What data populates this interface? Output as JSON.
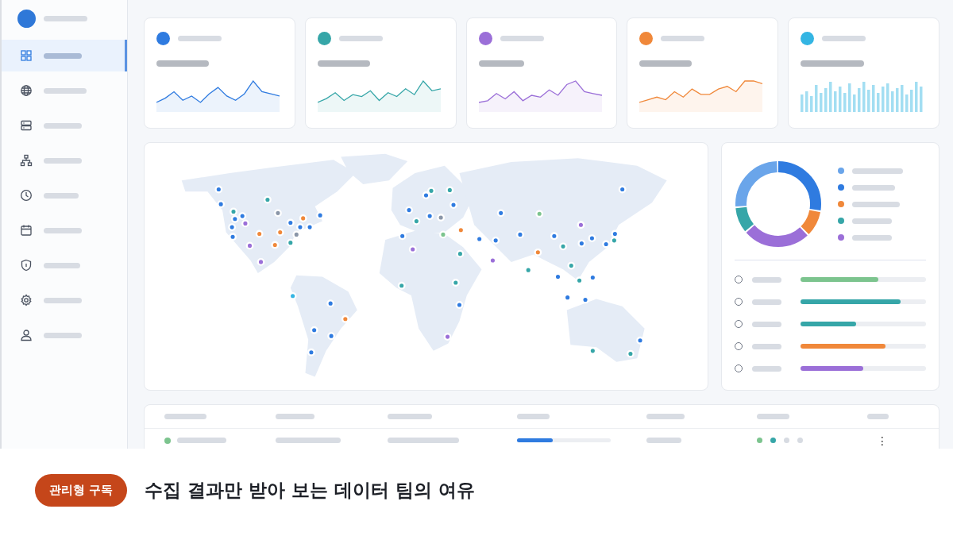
{
  "sidebar": {
    "items": [
      {
        "selected": true
      },
      {
        "selected": false
      },
      {
        "selected": false
      },
      {
        "selected": false
      },
      {
        "selected": false
      },
      {
        "selected": false
      },
      {
        "selected": false
      },
      {
        "selected": false
      },
      {
        "selected": false
      }
    ]
  },
  "stat_cards": [
    {
      "color": "#2f7be0",
      "kind": "line"
    },
    {
      "color": "#36a6a8",
      "kind": "line"
    },
    {
      "color": "#9b6fd8",
      "kind": "line"
    },
    {
      "color": "#f0883a",
      "kind": "line"
    },
    {
      "color": "#34b5e3",
      "kind": "bars"
    }
  ],
  "legend": [
    {
      "color": "#6aa5ea"
    },
    {
      "color": "#2f7be0"
    },
    {
      "color": "#f0883a"
    },
    {
      "color": "#36a6a8"
    },
    {
      "color": "#9b6fd8"
    }
  ],
  "progress_list": [
    {
      "selected": false,
      "color": "#7cc48e",
      "level": 0.62
    },
    {
      "selected": false,
      "color": "#36a6a8",
      "level": 0.8
    },
    {
      "selected": false,
      "color": "#36a6a8",
      "level": 0.44
    },
    {
      "selected": false,
      "color": "#f0883a",
      "level": 0.68
    },
    {
      "selected": false,
      "color": "#9b6fd8",
      "level": 0.5
    }
  ],
  "table": {
    "rows": [
      {
        "color": "#7cc48e",
        "level": 0.38,
        "dots": [
          {
            "color": "#7cc48e"
          },
          {
            "color": "#36a6a8"
          },
          {
            "color": "#d7dbe2"
          },
          {
            "color": "#d7dbe2"
          }
        ],
        "menu": "⋮"
      }
    ]
  },
  "promo": {
    "badge": "관리형 구독",
    "headline": "수집 결과만 받아 보는 데이터 팀의 여유"
  }
}
